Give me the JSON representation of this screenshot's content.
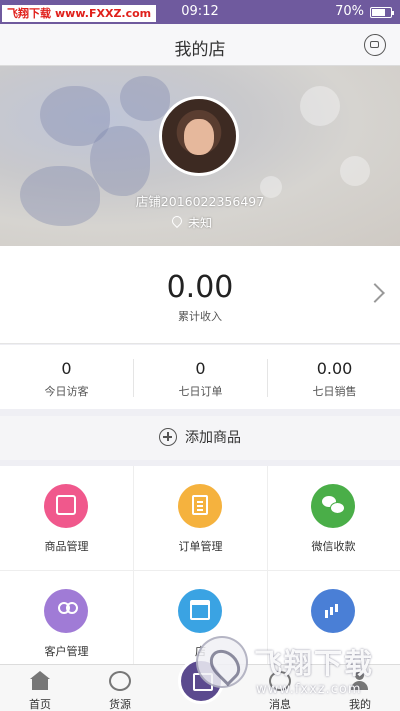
{
  "status_bar": {
    "watermark_site": "飞翔下载",
    "watermark_url": "www.FXXZ.com",
    "time": "09:12",
    "battery": "70%"
  },
  "nav": {
    "title": "我的店",
    "right_icon": "robot-icon"
  },
  "profile": {
    "shop_name": "店铺2016022356497",
    "location": "未知"
  },
  "income": {
    "value": "0.00",
    "label": "累计收入"
  },
  "stats": [
    {
      "value": "0",
      "label": "今日访客"
    },
    {
      "value": "0",
      "label": "七日订单"
    },
    {
      "value": "0.00",
      "label": "七日销售"
    }
  ],
  "add_product": {
    "label": "添加商品"
  },
  "grid": [
    {
      "label": "商品管理",
      "icon": "bag-icon",
      "color": "#f0588c"
    },
    {
      "label": "订单管理",
      "icon": "document-icon",
      "color": "#f5b23e"
    },
    {
      "label": "微信收款",
      "icon": "wechat-icon",
      "color": "#4aae48"
    },
    {
      "label": "客户管理",
      "icon": "users-icon",
      "color": "#a07bd6"
    },
    {
      "label": "店",
      "icon": "store-icon",
      "color": "#3aa3e3"
    },
    {
      "label": "",
      "icon": "chart-icon",
      "color": "#4a7fd6"
    }
  ],
  "tabs": [
    {
      "label": "首页",
      "icon": "home-icon"
    },
    {
      "label": "货源",
      "icon": "globe-icon"
    },
    {
      "label": "",
      "icon": "store-icon"
    },
    {
      "label": "消息",
      "icon": "chat-icon"
    },
    {
      "label": "我的",
      "icon": "user-icon"
    }
  ],
  "watermark": {
    "brand": "飞翔下载",
    "domain": "www.fxxz.com"
  }
}
